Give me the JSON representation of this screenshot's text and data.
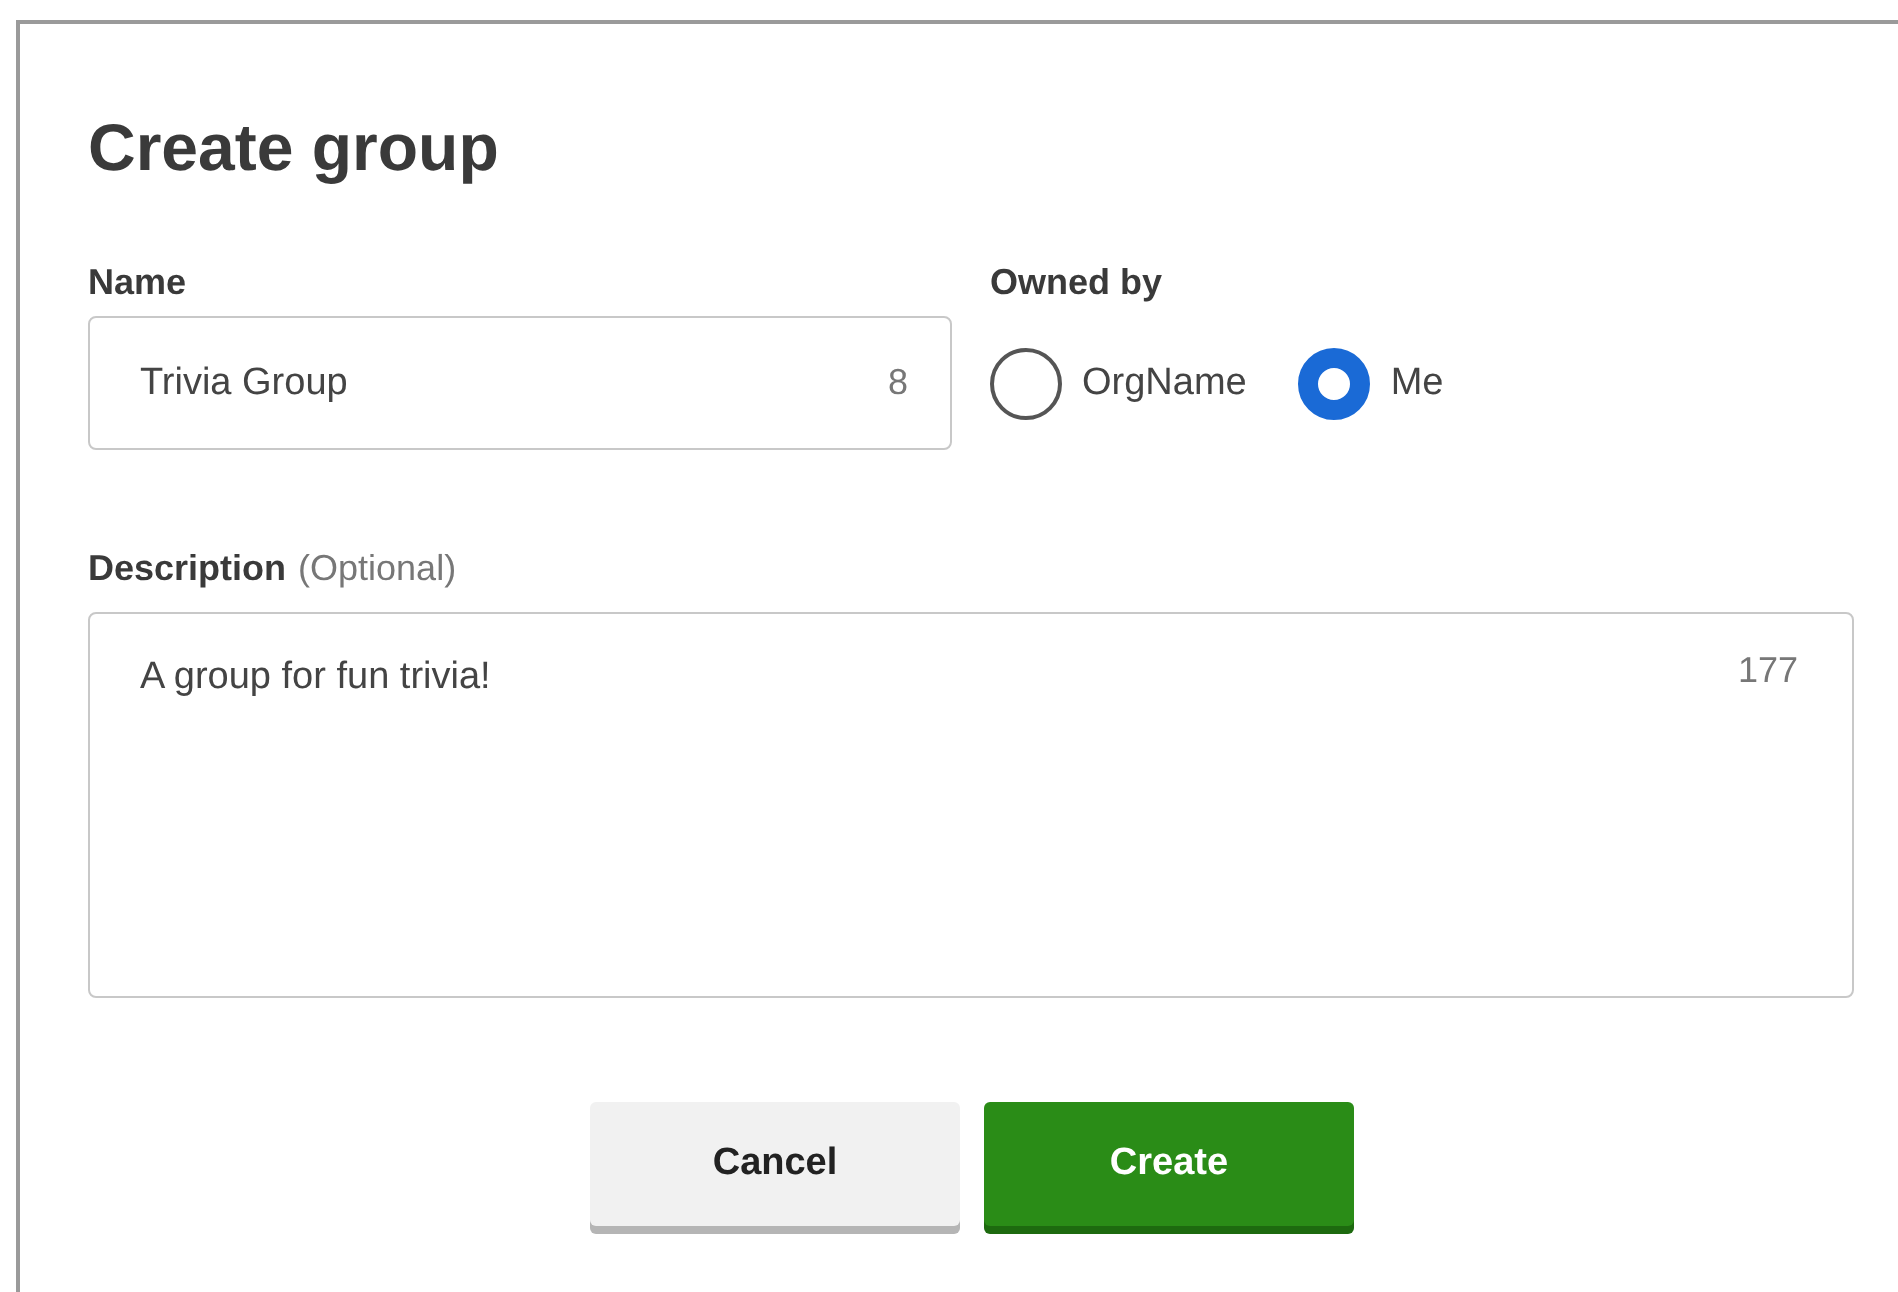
{
  "dialog": {
    "title": "Create group",
    "name_field": {
      "label": "Name",
      "value": "Trivia Group",
      "counter": "8"
    },
    "owned_by": {
      "label": "Owned by",
      "options": [
        {
          "label": "OrgName",
          "selected": false
        },
        {
          "label": "Me",
          "selected": true
        }
      ]
    },
    "description_field": {
      "label": "Description",
      "hint": "(Optional)",
      "value": "A group for fun trivia!",
      "counter": "177"
    },
    "buttons": [
      {
        "label": "Cancel",
        "kind": "secondary"
      },
      {
        "label": "Create",
        "kind": "primary"
      }
    ]
  }
}
